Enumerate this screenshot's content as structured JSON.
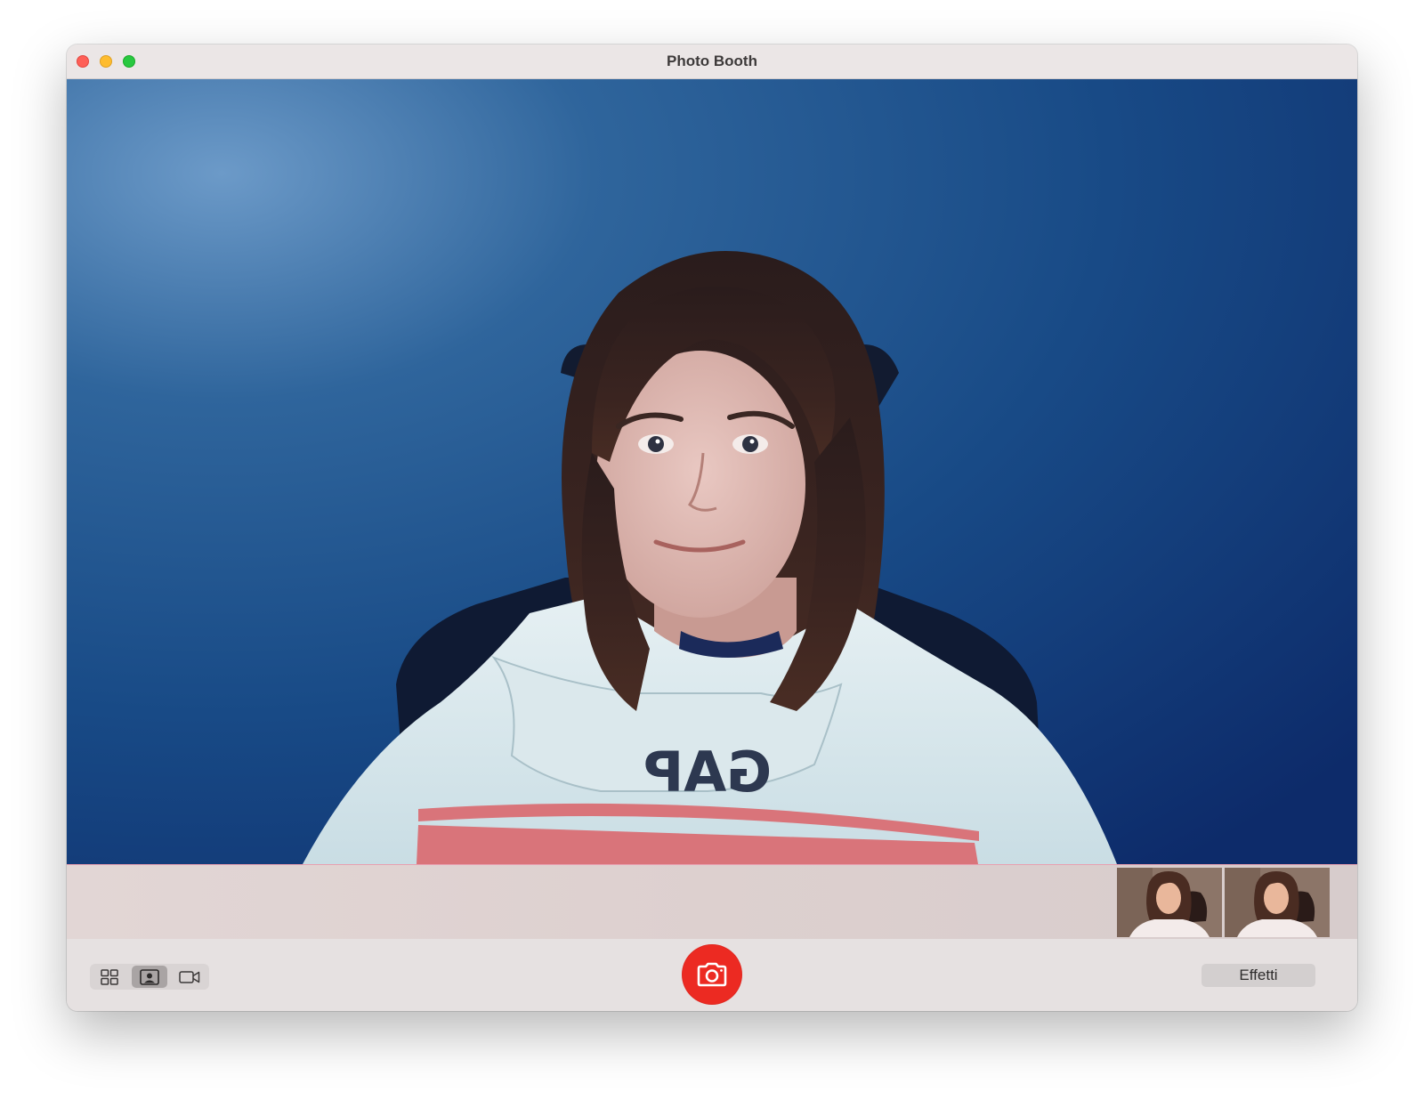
{
  "window": {
    "title": "Photo Booth"
  },
  "viewfinder": {
    "subject": "person-in-light-blue-hoodie",
    "background_color": "#1d4f8a"
  },
  "thumbnails": [
    {
      "name": "photo-thumbnail-1"
    },
    {
      "name": "photo-thumbnail-2"
    }
  ],
  "toolbar": {
    "modes": [
      {
        "name": "four-up-mode",
        "icon": "grid-icon",
        "active": false
      },
      {
        "name": "single-photo-mode",
        "icon": "portrait-icon",
        "active": true
      },
      {
        "name": "video-mode",
        "icon": "video-camera-icon",
        "active": false
      }
    ],
    "shutter_icon": "camera-icon",
    "effects_label": "Effetti"
  },
  "colors": {
    "shutter": "#ec2a22",
    "close": "#fe5f57",
    "minimize": "#febc2e",
    "maximize": "#28c840"
  }
}
